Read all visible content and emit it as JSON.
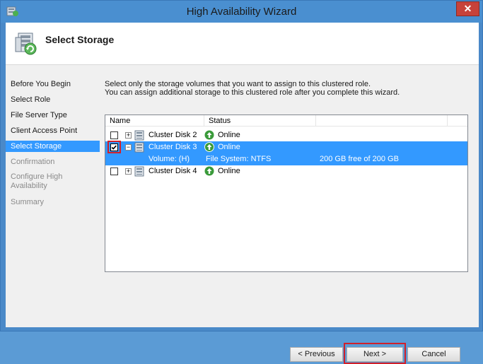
{
  "window": {
    "title": "High Availability Wizard",
    "close_glyph": "✕"
  },
  "header": {
    "title": "Select Storage"
  },
  "nav": {
    "items": [
      {
        "label": "Before You Begin",
        "state": "normal"
      },
      {
        "label": "Select Role",
        "state": "normal"
      },
      {
        "label": "File Server Type",
        "state": "normal"
      },
      {
        "label": "Client Access Point",
        "state": "normal"
      },
      {
        "label": "Select Storage",
        "state": "active"
      },
      {
        "label": "Confirmation",
        "state": "disabled"
      },
      {
        "label": "Configure High Availability",
        "state": "disabled"
      },
      {
        "label": "Summary",
        "state": "disabled"
      }
    ]
  },
  "content": {
    "line1": "Select only the storage volumes that you want to assign to this clustered role.",
    "line2": "You can assign additional storage to this clustered role after you complete this wizard."
  },
  "table": {
    "columns": [
      "Name",
      "Status"
    ],
    "rows": [
      {
        "name": "Cluster Disk 2",
        "status": "Online",
        "checked": false,
        "expander": "+"
      },
      {
        "name": "Cluster Disk 3",
        "status": "Online",
        "checked": true,
        "expander": "−",
        "sub": {
          "volume": "Volume: (H)",
          "fs": "File System: NTFS",
          "free": "200 GB free of 200 GB"
        }
      },
      {
        "name": "Cluster Disk 4",
        "status": "Online",
        "checked": false,
        "expander": "+"
      }
    ]
  },
  "buttons": {
    "previous": "< Previous",
    "next": "Next >",
    "cancel": "Cancel"
  },
  "colors": {
    "selection": "#3399ff",
    "highlight_box": "#d0202a",
    "titlebar": "#4a8fd0",
    "online_icon": "#3a9a3a"
  }
}
